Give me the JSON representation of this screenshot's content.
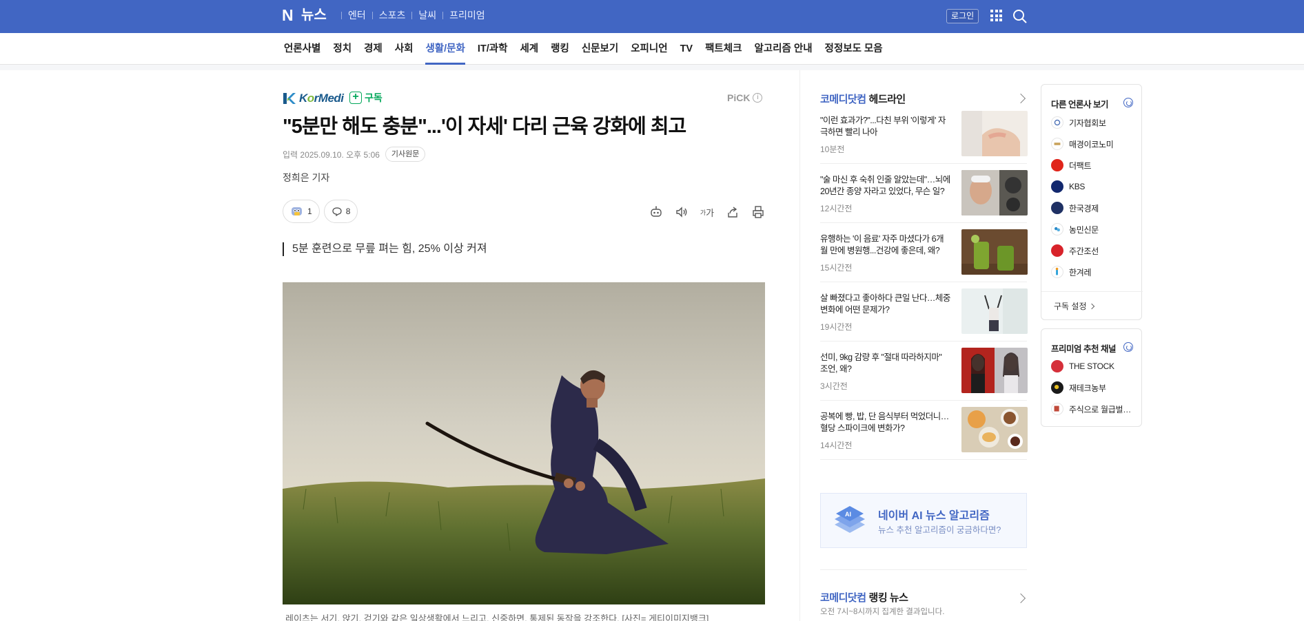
{
  "header": {
    "logo_letter": "N",
    "service_name": "뉴스",
    "top_links": [
      "엔터",
      "스포츠",
      "날씨",
      "프리미엄"
    ],
    "login_label": "로그인"
  },
  "categories": [
    "언론사별",
    "정치",
    "경제",
    "사회",
    "생활/문화",
    "IT/과학",
    "세계",
    "랭킹",
    "신문보기",
    "오피니언",
    "TV",
    "팩트체크",
    "알고리즘 안내",
    "정정보도 모음"
  ],
  "active_category": "생활/문화",
  "article": {
    "press_name_a": "K",
    "press_name_b": "o",
    "press_name_c": "rMedi",
    "subscribe_label": "구독",
    "pick_label": "PiCK",
    "pick_info": "i",
    "title": "\"5분만 해도 충분\"...'이 자세' 다리 근육 강화에 최고",
    "date_label": "입력 2025.09.10. 오후 5:06",
    "original_button": "기사원문",
    "reporter": "정희은 기자",
    "reaction_count": "1",
    "comment_count": "8",
    "text_size_label": "가",
    "summary": "5분 훈련으로 무릎 펴는 힘, 25% 이상 커져",
    "caption": "레이츠는 서기, 앉기, 걷기와 같은 일상생활에서 느리고, 신중하면, 통제된 동작을 강조한다. [사진= 게티이미지뱅크]"
  },
  "headline": {
    "press": "코메디닷컴",
    "title": "헤드라인",
    "items": [
      {
        "title": "\"이런 효과가?\"...다친 부위 '이렇게' 자극하면 빨리 나아",
        "time": "10분전"
      },
      {
        "title": "\"술 마신 후 숙취 인줄 알았는데\"…뇌에 20년간 종양 자라고 있었다, 무슨 일?",
        "time": "12시간전"
      },
      {
        "title": "유행하는 '이 음료' 자주 마셨다가 6개월 만에 병원행...건강에 좋은데, 왜?",
        "time": "15시간전"
      },
      {
        "title": "살 빠졌다고 좋아하다 큰일 난다…체중 변화에 어떤 문제가?",
        "time": "19시간전"
      },
      {
        "title": "선미, 9kg 감량 후 \"절대 따라하지마\" 조언, 왜?",
        "time": "3시간전"
      },
      {
        "title": "공복에 빵, 밥, 단 음식부터 먹었더니… 혈당 스파이크에 변화가?",
        "time": "14시간전"
      }
    ]
  },
  "ai_banner": {
    "title": "네이버 AI 뉴스 알고리즘",
    "subtitle": "뉴스 추천 알고리즘이 궁금하다면?",
    "badge": "AI"
  },
  "ranking": {
    "press": "코메디닷컴",
    "title": "랭킹 뉴스",
    "subtitle": "오전 7시~8시까지 집계한 결과입니다."
  },
  "other_press": {
    "title": "다른 언론사 보기",
    "items": [
      "기자협회보",
      "매경이코노미",
      "더팩트",
      "KBS",
      "한국경제",
      "농민신문",
      "주간조선",
      "한겨레"
    ],
    "footer": "구독 설정"
  },
  "premium": {
    "title": "프리미엄 추천 채널",
    "items": [
      "THE STOCK",
      "재테크농부",
      "주식으로 월급벌…"
    ]
  },
  "colors": {
    "brand_blue": "#4166c3",
    "subscribe_green": "#03a85a"
  }
}
